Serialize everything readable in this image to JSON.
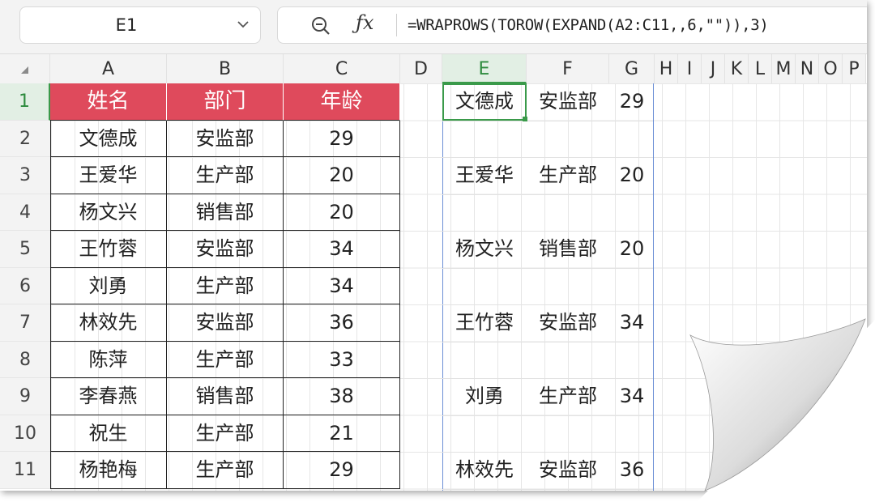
{
  "namebox": {
    "value": "E1"
  },
  "formula_bar": {
    "formula": "=WRAPROWS(TOROW(EXPAND(A2:C11,,6,\"\")),3)"
  },
  "columns": [
    "A",
    "B",
    "C",
    "D",
    "E",
    "F",
    "G",
    "H",
    "I",
    "J",
    "K",
    "L",
    "M",
    "N",
    "O",
    "P"
  ],
  "rows": [
    "1",
    "2",
    "3",
    "4",
    "5",
    "6",
    "7",
    "8",
    "9",
    "10",
    "11"
  ],
  "table": {
    "headers": [
      "姓名",
      "部门",
      "年龄"
    ],
    "rows": [
      [
        "文德成",
        "安监部",
        "29"
      ],
      [
        "王爱华",
        "生产部",
        "20"
      ],
      [
        "杨文兴",
        "销售部",
        "20"
      ],
      [
        "王竹蓉",
        "安监部",
        "34"
      ],
      [
        "刘勇",
        "生产部",
        "34"
      ],
      [
        "林效先",
        "安监部",
        "36"
      ],
      [
        "陈萍",
        "生产部",
        "33"
      ],
      [
        "李春燕",
        "销售部",
        "38"
      ],
      [
        "祝生",
        "生产部",
        "21"
      ],
      [
        "杨艳梅",
        "生产部",
        "29"
      ]
    ]
  },
  "result": {
    "rows": [
      [
        "文德成",
        "安监部",
        "29"
      ],
      [
        "",
        "",
        ""
      ],
      [
        "王爱华",
        "生产部",
        "20"
      ],
      [
        "",
        "",
        ""
      ],
      [
        "杨文兴",
        "销售部",
        "20"
      ],
      [
        "",
        "",
        ""
      ],
      [
        "王竹蓉",
        "安监部",
        "34"
      ],
      [
        "",
        "",
        ""
      ],
      [
        "刘勇",
        "生产部",
        "34"
      ],
      [
        "",
        "",
        ""
      ],
      [
        "林效先",
        "安监部",
        "36"
      ]
    ]
  },
  "colors": {
    "header_fill": "#df4a5c",
    "selection": "#3a9a4a",
    "result_border": "#6b8fd6"
  }
}
